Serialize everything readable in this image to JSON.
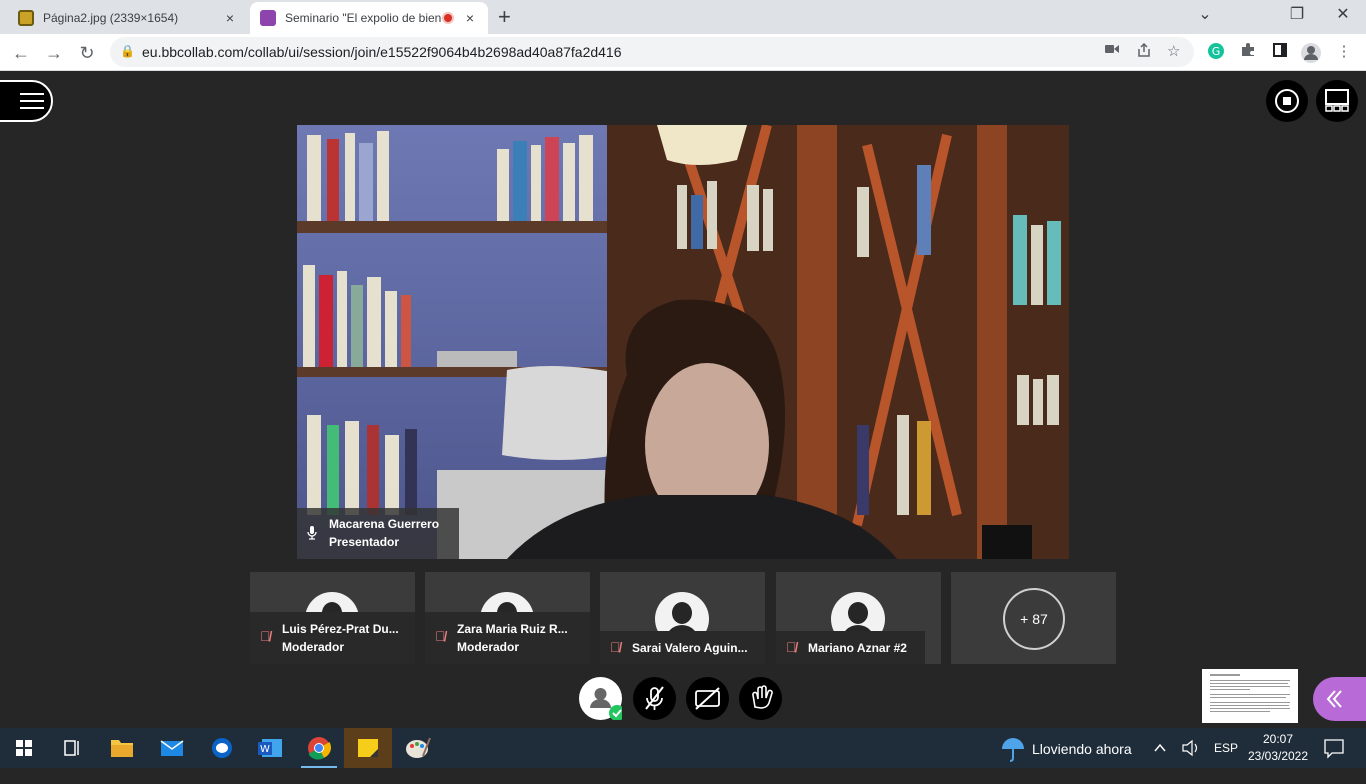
{
  "browser": {
    "tabs": [
      {
        "title": "Página2.jpg (2339×1654)",
        "close": "×"
      },
      {
        "title": "Seminario \"El expolio de bienes",
        "close": "×"
      }
    ],
    "new_tab": "+",
    "window_controls": {
      "minimize": "⌄",
      "restore": "❐",
      "close": "✕"
    },
    "url": "eu.bbcollab.com/collab/ui/session/join/e15522f9064b4b2698ad40a87fa2d416",
    "nav": {
      "back": "←",
      "forward": "→",
      "reload": "↻"
    }
  },
  "session": {
    "presenter": {
      "name": "Macarena Guerrero",
      "role": "Presentador"
    },
    "participants": [
      {
        "name": "Luis Pérez-Prat Du...",
        "role": "Moderador"
      },
      {
        "name": "Zara Maria Ruiz R...",
        "role": "Moderador"
      },
      {
        "name": "Sarai Valero Aguin...",
        "role": ""
      },
      {
        "name": "Mariano Aznar #2",
        "role": ""
      }
    ],
    "more_count": "+ 87"
  },
  "taskbar": {
    "weather": "Lloviendo ahora",
    "language": "ESP",
    "time": "20:07",
    "date": "23/03/2022"
  },
  "icons": {
    "menu": "hamburger-icon",
    "record": "record-stop-icon",
    "layout": "layout-icon",
    "mic_off": "mic-off-icon",
    "camera_off": "camera-off-icon",
    "hand": "raise-hand-icon",
    "collapse": "double-chevron-left-icon"
  },
  "colors": {
    "background": "#262626",
    "tile": "#3b3b3b",
    "accent_purple": "#b86bd6",
    "status_green": "#22c55e",
    "mute_red": "#f08080",
    "taskbar": "#1f2d3a"
  }
}
